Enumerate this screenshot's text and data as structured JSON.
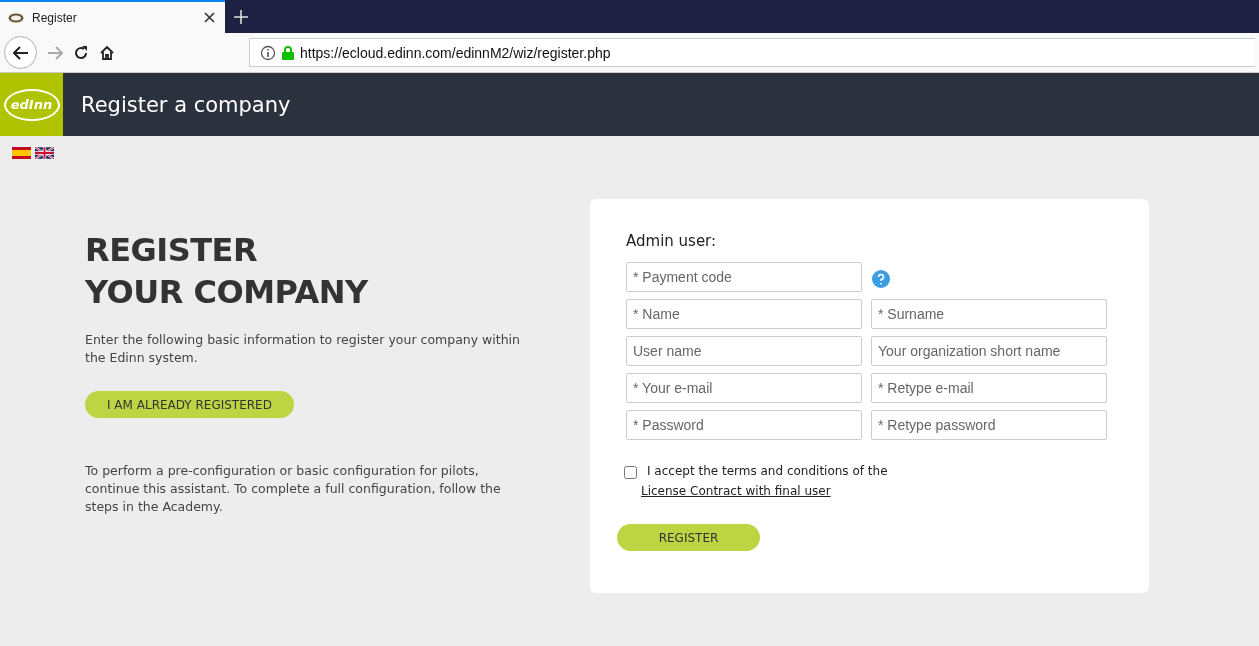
{
  "browser": {
    "tab": {
      "title": "Register",
      "selected": true
    },
    "url": "https://ecloud.edinn.com/edinnM2/wiz/register.php"
  },
  "header": {
    "logo_text": "edInn",
    "title": "Register a company"
  },
  "intro": {
    "heading_lines": [
      "REGISTER",
      "YOUR COMPANY"
    ],
    "description": "Enter the following basic information to register your company within the Edinn system.",
    "already_button": "I AM ALREADY REGISTERED",
    "note": "To perform a pre-configuration or basic configuration for pilots, continue this assistant. To complete a full configuration, follow the steps in the Academy."
  },
  "form": {
    "title": "Admin user:",
    "rows": [
      [
        {
          "placeholder": "* Payment code",
          "help": true
        }
      ],
      [
        {
          "placeholder": "* Name",
          "help": false
        },
        {
          "placeholder": "* Surname",
          "help": false
        }
      ],
      [
        {
          "placeholder": "User name",
          "help": false
        },
        {
          "placeholder": "Your organization short name",
          "help": false
        }
      ],
      [
        {
          "placeholder": "* Your e-mail",
          "help": false
        },
        {
          "placeholder": "* Retype e-mail",
          "help": false
        }
      ],
      [
        {
          "placeholder": "* Password",
          "help": false
        },
        {
          "placeholder": "* Retype password",
          "help": false
        }
      ]
    ],
    "terms": {
      "checked": false,
      "text": "I accept the terms and conditions of the",
      "link": "License Contract with final user"
    },
    "submit": "REGISTER"
  }
}
